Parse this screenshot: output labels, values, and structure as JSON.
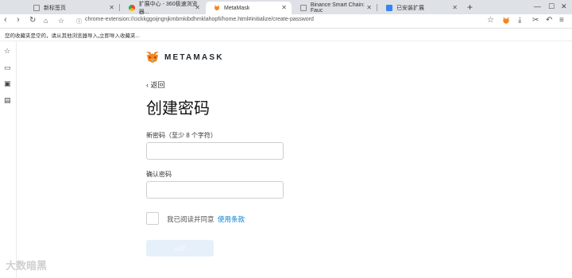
{
  "tabs": [
    {
      "label": "新标签页",
      "active": false
    },
    {
      "label": "扩展中心 - 360极速浏览器...",
      "active": false
    },
    {
      "label": "MetaMask",
      "active": true
    },
    {
      "label": "Binance Smart Chain: Fauc",
      "active": false
    },
    {
      "label": "已安装扩展",
      "active": false
    }
  ],
  "toolbar": {
    "url": "chrome-extension://cickkggoijngnjkmbmkibdhmklahopfi/home.html#initialize/create-password"
  },
  "bookmarks": {
    "message": "您的收藏夹是空的，请从其他浏览器导入。",
    "import_link": "立即导入收藏夹..."
  },
  "brand": {
    "logo_text": "METAMASK"
  },
  "page": {
    "back_label": "返回",
    "title": "创建密码",
    "new_password_label": "新密码（至少 8 个字符）",
    "confirm_password_label": "确认密码",
    "agree_text": "我已阅读并同意",
    "terms_link": "使用条款",
    "create_button": "创建"
  },
  "watermark": "大数暗黑",
  "colors": {
    "accent": "#037dd6",
    "button_disabled_bg": "#e6f0fb",
    "metamask_orange": "#e2761b"
  }
}
